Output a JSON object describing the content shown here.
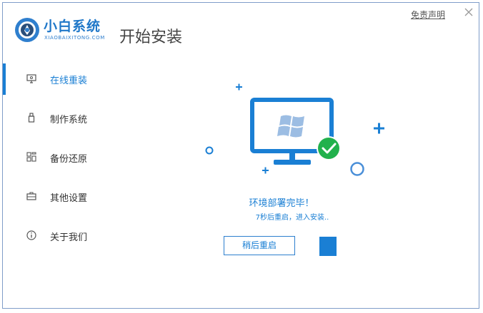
{
  "brand": {
    "name": "小白系统",
    "sub": "XIAOBAIXITONG.COM",
    "accent": "#1a7fd4"
  },
  "page_title": "开始安装",
  "top_link": "免责声明",
  "sidebar": {
    "items": [
      {
        "label": "在线重装",
        "icon": "monitor-icon",
        "active": true
      },
      {
        "label": "制作系统",
        "icon": "usb-icon",
        "active": false
      },
      {
        "label": "备份还原",
        "icon": "backup-grid-icon",
        "active": false
      },
      {
        "label": "其他设置",
        "icon": "briefcase-icon",
        "active": false
      },
      {
        "label": "关于我们",
        "icon": "info-icon",
        "active": false
      }
    ]
  },
  "main": {
    "status_title": "环境部署完毕！",
    "status_sub": "7秒后重启，进入安装..",
    "later_button": "稍后重启",
    "success_color": "#22b14c"
  }
}
